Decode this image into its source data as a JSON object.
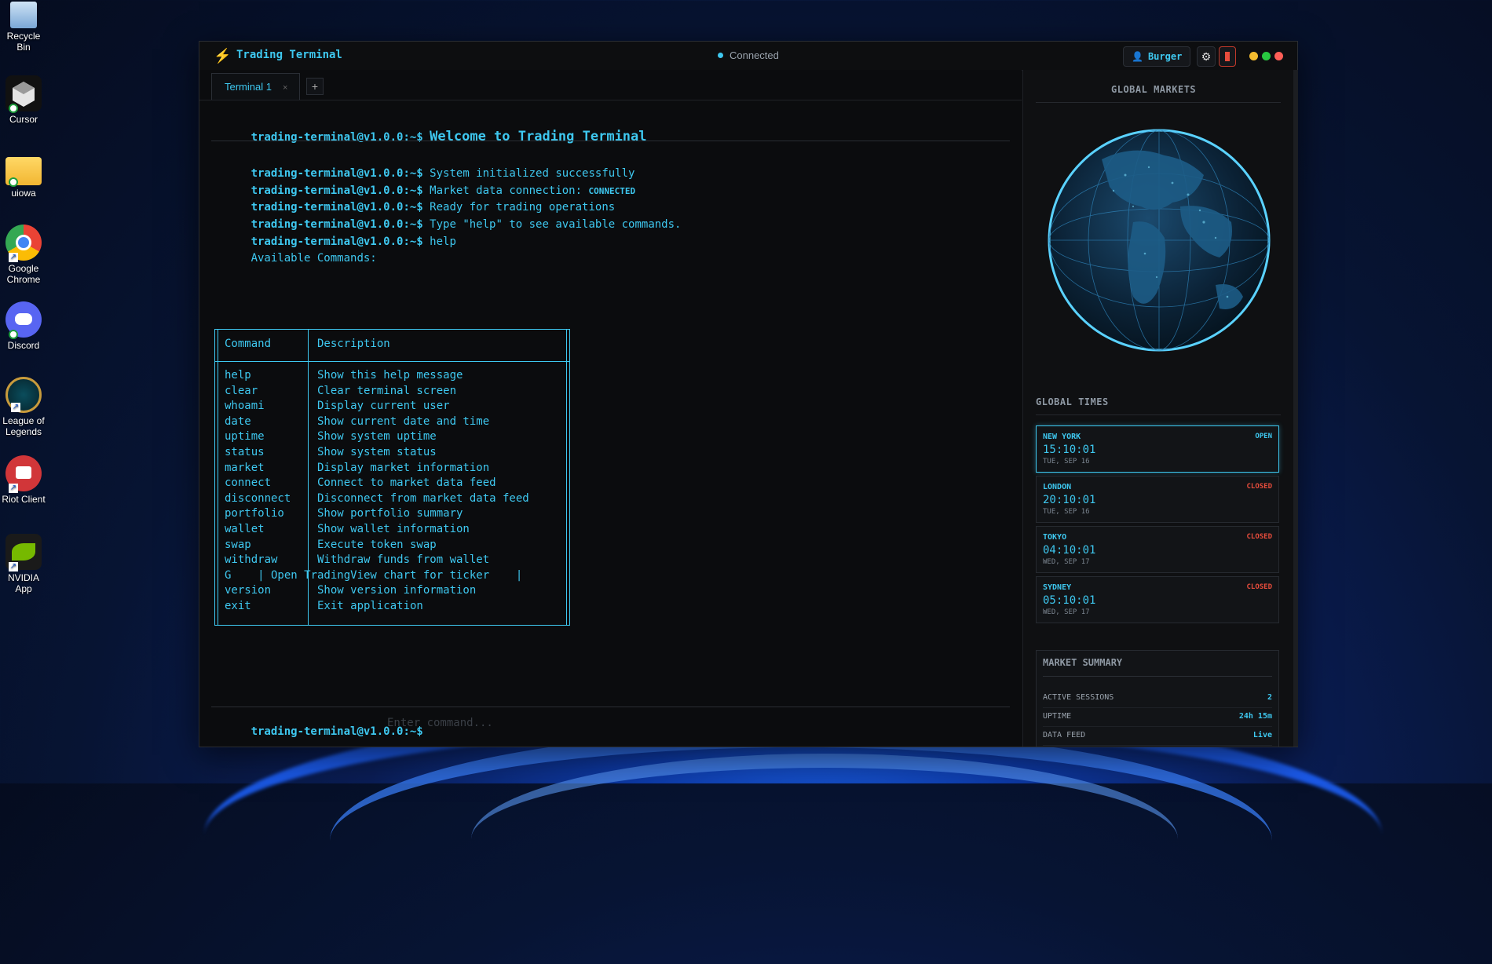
{
  "desktop": {
    "icons": [
      {
        "label": "Recycle Bin"
      },
      {
        "label": "Cursor"
      },
      {
        "label": "uiowa"
      },
      {
        "label": "Google Chrome"
      },
      {
        "label": "Discord"
      },
      {
        "label": "League of Legends"
      },
      {
        "label": "Riot Client"
      },
      {
        "label": "NVIDIA App"
      }
    ]
  },
  "window": {
    "title": "Trading Terminal",
    "status": "Connected",
    "user": "Burger",
    "colors": {
      "accent": "#3ec8f0",
      "closed": "#e74c3c",
      "app_icon": "#f28b30"
    }
  },
  "tabs": {
    "items": [
      {
        "label": "Terminal 1",
        "close": "×"
      }
    ],
    "new_tab_label": "+"
  },
  "terminal": {
    "prompt": "trading-terminal@v1.0.0:~$",
    "welcome": "Welcome to Trading Terminal",
    "lines": [
      "System initialized successfully",
      "Market data connection: ",
      "Ready for trading operations",
      "Type \"help\" to see available commands.",
      "help"
    ],
    "connection_state": "CONNECTED",
    "available_header": "Available Commands:",
    "table": {
      "headers": [
        "Command",
        "Description"
      ],
      "rows": [
        [
          "help",
          "Show this help message"
        ],
        [
          "clear",
          "Clear terminal screen"
        ],
        [
          "whoami",
          "Display current user"
        ],
        [
          "date",
          "Show current date and time"
        ],
        [
          "uptime",
          "Show system uptime"
        ],
        [
          "status",
          "Show system status"
        ],
        [
          "market",
          "Display market information"
        ],
        [
          "connect",
          "Connect to market data feed"
        ],
        [
          "disconnect",
          "Disconnect from market data feed"
        ],
        [
          "portfolio",
          "Show portfolio summary"
        ],
        [
          "wallet",
          "Show wallet information"
        ],
        [
          "swap",
          "Execute token swap"
        ],
        [
          "withdraw",
          "Withdraw funds from wallet"
        ],
        [
          "G    | Open TradingView chart for ticker    |",
          ""
        ],
        [
          "version",
          "Show version information"
        ],
        [
          "exit",
          "Exit application"
        ]
      ]
    },
    "input_placeholder": "Enter command..."
  },
  "panel": {
    "markets_title": "GLOBAL MARKETS",
    "times_title": "GLOBAL TIMES",
    "markets": [
      {
        "city": "NEW YORK",
        "state": "OPEN",
        "time": "15:10:01",
        "date": "TUE, SEP 16"
      },
      {
        "city": "LONDON",
        "state": "CLOSED",
        "time": "20:10:01",
        "date": "TUE, SEP 16"
      },
      {
        "city": "TOKYO",
        "state": "CLOSED",
        "time": "04:10:01",
        "date": "WED, SEP 17"
      },
      {
        "city": "SYDNEY",
        "state": "CLOSED",
        "time": "05:10:01",
        "date": "WED, SEP 17"
      }
    ],
    "summary": {
      "title": "MARKET SUMMARY",
      "rows": [
        {
          "key": "ACTIVE SESSIONS",
          "value": "2"
        },
        {
          "key": "UPTIME",
          "value": "24h 15m"
        },
        {
          "key": "DATA FEED",
          "value": "Live"
        }
      ]
    }
  }
}
